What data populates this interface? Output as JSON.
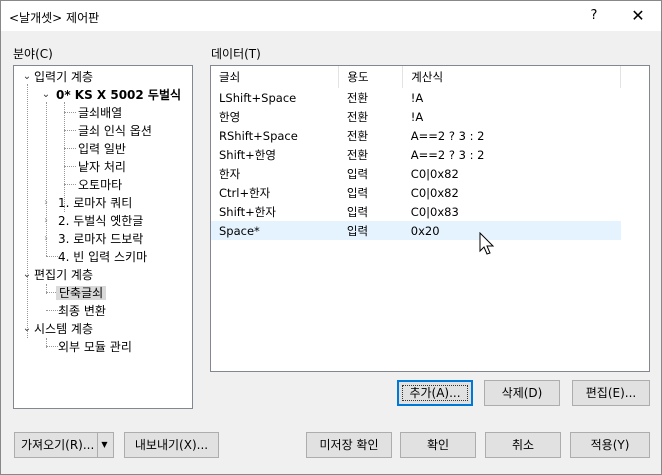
{
  "window": {
    "title": "<날개셋> 제어판",
    "help": "?",
    "close": "✕"
  },
  "tree": {
    "label": "분야(C)",
    "items": [
      {
        "text": "입력기 계층"
      },
      {
        "text": "0* KS X 5002 두벌식"
      },
      {
        "text": "글쇠배열"
      },
      {
        "text": "글쇠 인식 옵션"
      },
      {
        "text": "입력 일반"
      },
      {
        "text": "낱자 처리"
      },
      {
        "text": "오토마타"
      },
      {
        "text": "1. 로마자 쿼티"
      },
      {
        "text": "2. 두벌식 옛한글"
      },
      {
        "text": "3. 로마자 드보락"
      },
      {
        "text": "4. 빈 입력 스키마"
      },
      {
        "text": "편집기 계층"
      },
      {
        "text": "단축글쇠"
      },
      {
        "text": "최종 변환"
      },
      {
        "text": "시스템 계층"
      },
      {
        "text": "외부 모듈 관리"
      }
    ]
  },
  "data_panel": {
    "label": "데이터(T)",
    "columns": [
      "글쇠",
      "용도",
      "계산식"
    ],
    "rows": [
      [
        "LShift+Space",
        "전환",
        "!A"
      ],
      [
        "한영",
        "전환",
        "!A"
      ],
      [
        "RShift+Space",
        "전환",
        "A==2 ? 3 : 2"
      ],
      [
        "Shift+한영",
        "전환",
        "A==2 ? 3 : 2"
      ],
      [
        "한자",
        "입력",
        "C0|0x82"
      ],
      [
        "Ctrl+한자",
        "입력",
        "C0|0x82"
      ],
      [
        "Shift+한자",
        "입력",
        "C0|0x83"
      ],
      [
        "Space*",
        "입력",
        "0x20"
      ]
    ]
  },
  "buttons": {
    "add": "추가(A)...",
    "delete": "삭제(D)",
    "edit": "편집(E)...",
    "import": "가져오기(R)...",
    "export": "내보내기(X)...",
    "unsaved": "미저장 확인",
    "ok": "확인",
    "cancel": "취소",
    "apply": "적용(Y)"
  },
  "colors": {
    "selection": "#e5f3ff",
    "default_button_border": "#0078d7"
  }
}
